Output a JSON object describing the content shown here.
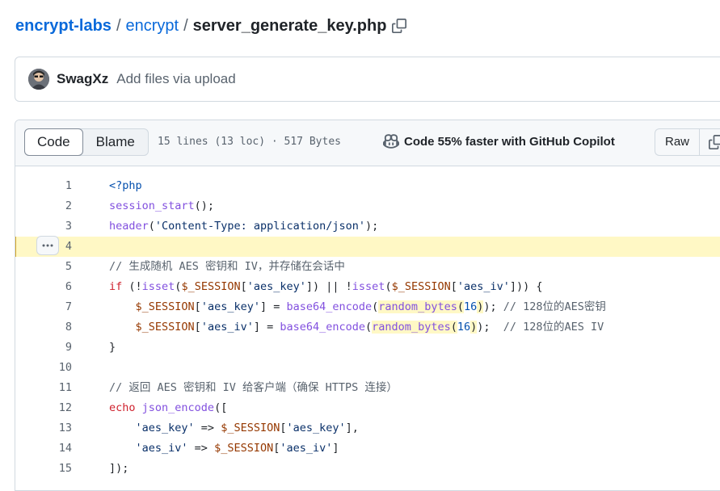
{
  "breadcrumb": {
    "owner": "encrypt-labs",
    "sep1": "/",
    "repo": "encrypt",
    "sep2": "/",
    "file": "server_generate_key.php"
  },
  "commit": {
    "author": "SwagXz",
    "message": "Add files via upload"
  },
  "file_header": {
    "tabs": [
      "Code",
      "Blame"
    ],
    "active_tab": "Code",
    "info": "15 lines (13 loc) · 517 Bytes",
    "copilot_text": "Code 55% faster with GitHub Copilot",
    "raw_label": "Raw"
  },
  "code": {
    "highlighted_line": 4,
    "line_numbers": [
      "1",
      "2",
      "3",
      "4",
      "5",
      "6",
      "7",
      "8",
      "9",
      "10",
      "11",
      "12",
      "13",
      "14",
      "15"
    ],
    "lines": [
      "<?php",
      "session_start();",
      "header('Content-Type: application/json');",
      "",
      "// 生成随机 AES 密钥和 IV，并存储在会话中",
      "if (!isset($_SESSION['aes_key']) || !isset($_SESSION['aes_iv'])) {",
      "    $_SESSION['aes_key'] = base64_encode(random_bytes(16)); // 128位的AES密钥",
      "    $_SESSION['aes_iv'] = base64_encode(random_bytes(16));  // 128位的AES IV",
      "}",
      "",
      "// 返回 AES 密钥和 IV 给客户端（确保 HTTPS 连接）",
      "echo json_encode([",
      "    'aes_key' => $_SESSION['aes_key'],",
      "    'aes_iv' => $_SESSION['aes_iv']",
      "]);"
    ]
  },
  "icons": {
    "copy": "copy-icon",
    "copilot": "copilot-icon",
    "kebab": "kebab-horizontal-icon"
  },
  "colors": {
    "link": "#0969da",
    "highlight": "#fff8c5",
    "keyword": "#cf222e",
    "function": "#8250df",
    "string": "#0a3069",
    "variable": "#953800"
  }
}
